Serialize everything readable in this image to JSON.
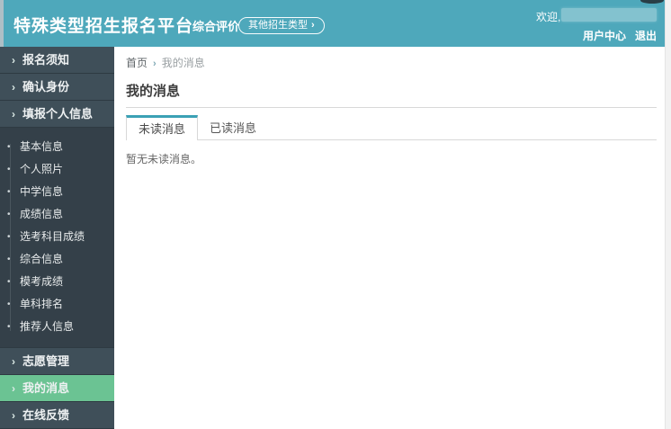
{
  "header": {
    "title": "特殊类型招生报名平台",
    "subtitle": "综合评价",
    "other_types_label": "其他招生类型",
    "welcome": "欢迎,",
    "user_center": "用户中心",
    "logout": "退出"
  },
  "icons": {
    "chevron_right": "›",
    "bullet": "•",
    "breadcrumb_separator": "›"
  },
  "colors": {
    "header_teal": "#4ea8bb",
    "sidebar_dark": "#3f4f59",
    "sidebar_sub_dark": "#344049",
    "active_green": "#6bc393",
    "tab_accent_teal": "#3ba1b5"
  },
  "sidebar": {
    "items": [
      {
        "label": "报名须知"
      },
      {
        "label": "确认身份"
      },
      {
        "label": "填报个人信息"
      },
      {
        "label": "基本信息"
      },
      {
        "label": "个人照片"
      },
      {
        "label": "中学信息"
      },
      {
        "label": "成绩信息"
      },
      {
        "label": "选考科目成绩"
      },
      {
        "label": "综合信息"
      },
      {
        "label": "模考成绩"
      },
      {
        "label": "单科排名"
      },
      {
        "label": "推荐人信息"
      },
      {
        "label": "志愿管理"
      },
      {
        "label": "我的消息",
        "active": true
      },
      {
        "label": "在线反馈"
      }
    ]
  },
  "breadcrumb": {
    "home": "首页",
    "current": "我的消息"
  },
  "main": {
    "title": "我的消息",
    "empty_message": "暂无未读消息。"
  },
  "tabs": [
    {
      "label": "未读消息",
      "active": true
    },
    {
      "label": "已读消息",
      "active": false
    }
  ]
}
